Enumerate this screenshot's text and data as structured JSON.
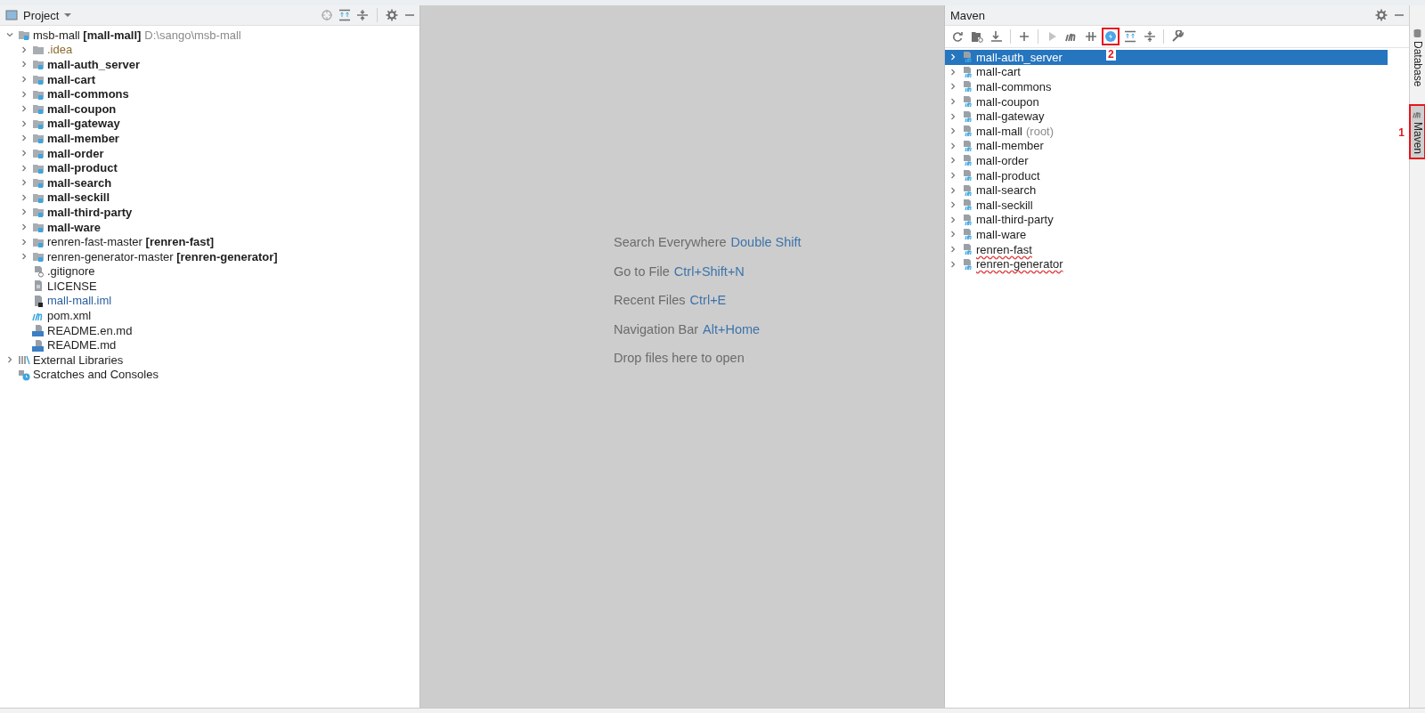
{
  "project_panel": {
    "title": "Project",
    "tree": [
      {
        "label": "msb-mall **[mall-mall]**",
        "path": "D:\\sango\\msb-mall",
        "kind": "module",
        "bold": false,
        "expanded": true,
        "children": [
          {
            "label": ".idea",
            "kind": "excluded-folder",
            "bold": false,
            "expanded": false
          },
          {
            "label": "mall-auth_server",
            "kind": "module",
            "bold": true,
            "expanded": false
          },
          {
            "label": "mall-cart",
            "kind": "module",
            "bold": true,
            "expanded": false
          },
          {
            "label": "mall-commons",
            "kind": "module",
            "bold": true,
            "expanded": false
          },
          {
            "label": "mall-coupon",
            "kind": "module",
            "bold": true,
            "expanded": false
          },
          {
            "label": "mall-gateway",
            "kind": "module",
            "bold": true,
            "expanded": false
          },
          {
            "label": "mall-member",
            "kind": "module",
            "bold": true,
            "expanded": false
          },
          {
            "label": "mall-order",
            "kind": "module",
            "bold": true,
            "expanded": false
          },
          {
            "label": "mall-product",
            "kind": "module",
            "bold": true,
            "expanded": false
          },
          {
            "label": "mall-search",
            "kind": "module",
            "bold": true,
            "expanded": false
          },
          {
            "label": "mall-seckill",
            "kind": "module",
            "bold": true,
            "expanded": false
          },
          {
            "label": "mall-third-party",
            "kind": "module",
            "bold": true,
            "expanded": false
          },
          {
            "label": "mall-ware",
            "kind": "module",
            "bold": true,
            "expanded": false
          },
          {
            "label": "renren-fast-master **[renren-fast]**",
            "kind": "module",
            "bold": false,
            "expanded": false
          },
          {
            "label": "renren-generator-master **[renren-generator]**",
            "kind": "module",
            "bold": false,
            "expanded": false
          },
          {
            "label": ".gitignore",
            "kind": "ignore-file",
            "bold": false
          },
          {
            "label": "LICENSE",
            "kind": "text-file",
            "bold": false
          },
          {
            "label": "mall-mall.iml",
            "kind": "iml-file",
            "bold": false
          },
          {
            "label": "pom.xml",
            "kind": "pom-file",
            "bold": false
          },
          {
            "label": "README.en.md",
            "kind": "markdown-file",
            "bold": false
          },
          {
            "label": "README.md",
            "kind": "markdown-file",
            "bold": false
          }
        ]
      },
      {
        "label": "External Libraries",
        "kind": "libraries",
        "bold": false,
        "expanded": false
      },
      {
        "label": "Scratches and Consoles",
        "kind": "scratches",
        "bold": false
      }
    ]
  },
  "editor_hints": [
    {
      "text": "Search Everywhere",
      "shortcut": "Double Shift"
    },
    {
      "text": "Go to File",
      "shortcut": "Ctrl+Shift+N"
    },
    {
      "text": "Recent Files",
      "shortcut": "Ctrl+E"
    },
    {
      "text": "Navigation Bar",
      "shortcut": "Alt+Home"
    },
    {
      "text": "Drop files here to open"
    }
  ],
  "maven_panel": {
    "title": "Maven",
    "toolbar": [
      {
        "kind": "reload",
        "highlighted": false
      },
      {
        "kind": "folder-reload",
        "highlighted": false
      },
      {
        "kind": "download",
        "highlighted": false
      },
      {
        "kind": "separator"
      },
      {
        "kind": "add",
        "highlighted": false
      },
      {
        "kind": "separator"
      },
      {
        "kind": "run",
        "highlighted": false,
        "disabled": true
      },
      {
        "kind": "maven",
        "highlighted": false
      },
      {
        "kind": "offline",
        "highlighted": false
      },
      {
        "kind": "skip-tests",
        "highlighted": true,
        "callout": "2"
      },
      {
        "kind": "expand-all",
        "highlighted": false
      },
      {
        "kind": "collapse-all",
        "highlighted": false
      },
      {
        "kind": "separator"
      },
      {
        "kind": "settings",
        "highlighted": false
      }
    ],
    "projects": [
      {
        "label": "mall-auth_server",
        "selected": true,
        "expanded": false
      },
      {
        "label": "mall-cart",
        "selected": false,
        "expanded": false
      },
      {
        "label": "mall-commons",
        "selected": false,
        "expanded": false
      },
      {
        "label": "mall-coupon",
        "selected": false,
        "expanded": false
      },
      {
        "label": "mall-gateway",
        "selected": false,
        "expanded": false
      },
      {
        "label": "mall-mall",
        "note": "(root)",
        "selected": false,
        "expanded": false
      },
      {
        "label": "mall-member",
        "selected": false,
        "expanded": false
      },
      {
        "label": "mall-order",
        "selected": false,
        "expanded": false
      },
      {
        "label": "mall-product",
        "selected": false,
        "expanded": false
      },
      {
        "label": "mall-search",
        "selected": false,
        "expanded": false
      },
      {
        "label": "mall-seckill",
        "selected": false,
        "expanded": false
      },
      {
        "label": "mall-third-party",
        "selected": false,
        "expanded": false
      },
      {
        "label": "mall-ware",
        "selected": false,
        "expanded": false
      },
      {
        "label": "renren-fast",
        "selected": false,
        "expanded": false,
        "misspelled": true
      },
      {
        "label": "renren-generator",
        "selected": false,
        "expanded": false,
        "misspelled": true
      }
    ]
  },
  "side_tabs": [
    {
      "label": "Database",
      "kind": "database",
      "selected": false,
      "highlighted": false
    },
    {
      "label": "Maven",
      "kind": "maven",
      "selected": true,
      "highlighted": true,
      "callout": "1"
    }
  ]
}
